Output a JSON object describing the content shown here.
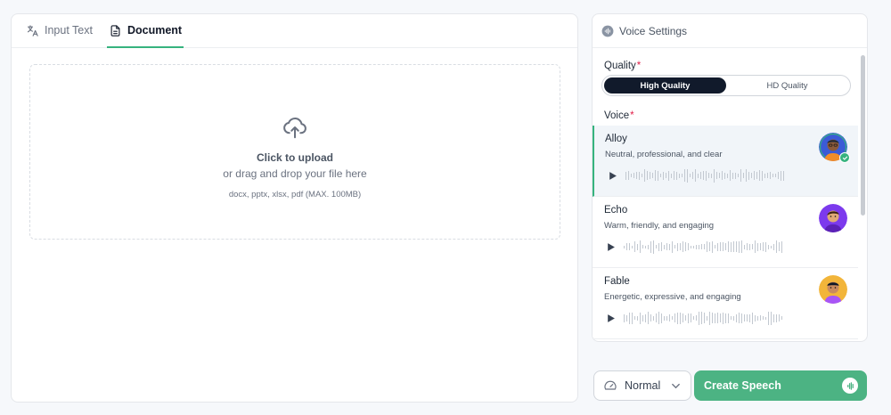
{
  "tabs": [
    {
      "label": "Input Text",
      "icon": "translate-icon",
      "active": false
    },
    {
      "label": "Document",
      "icon": "document-icon",
      "active": true
    }
  ],
  "upload": {
    "title": "Click to upload",
    "subtitle": "or drag and drop your file here",
    "hint": "docx, pptx, xlsx, pdf (MAX. 100MB)",
    "icon": "cloud-upload-icon"
  },
  "voice_settings": {
    "title": "Voice Settings",
    "quality_label": "Quality",
    "quality_options": [
      "High Quality",
      "HD Quality"
    ],
    "quality_selected": "High Quality",
    "voice_label": "Voice",
    "voices": [
      {
        "name": "Alloy",
        "desc": "Neutral, professional, and clear",
        "selected": true
      },
      {
        "name": "Echo",
        "desc": "Warm, friendly, and engaging",
        "selected": false
      },
      {
        "name": "Fable",
        "desc": "Energetic, expressive, and engaging",
        "selected": false
      }
    ]
  },
  "speed": {
    "value": "Normal"
  },
  "create_button": {
    "label": "Create Speech"
  },
  "colors": {
    "accent": "#4cb383",
    "dark": "#111a2b",
    "required": "#e11d48"
  }
}
